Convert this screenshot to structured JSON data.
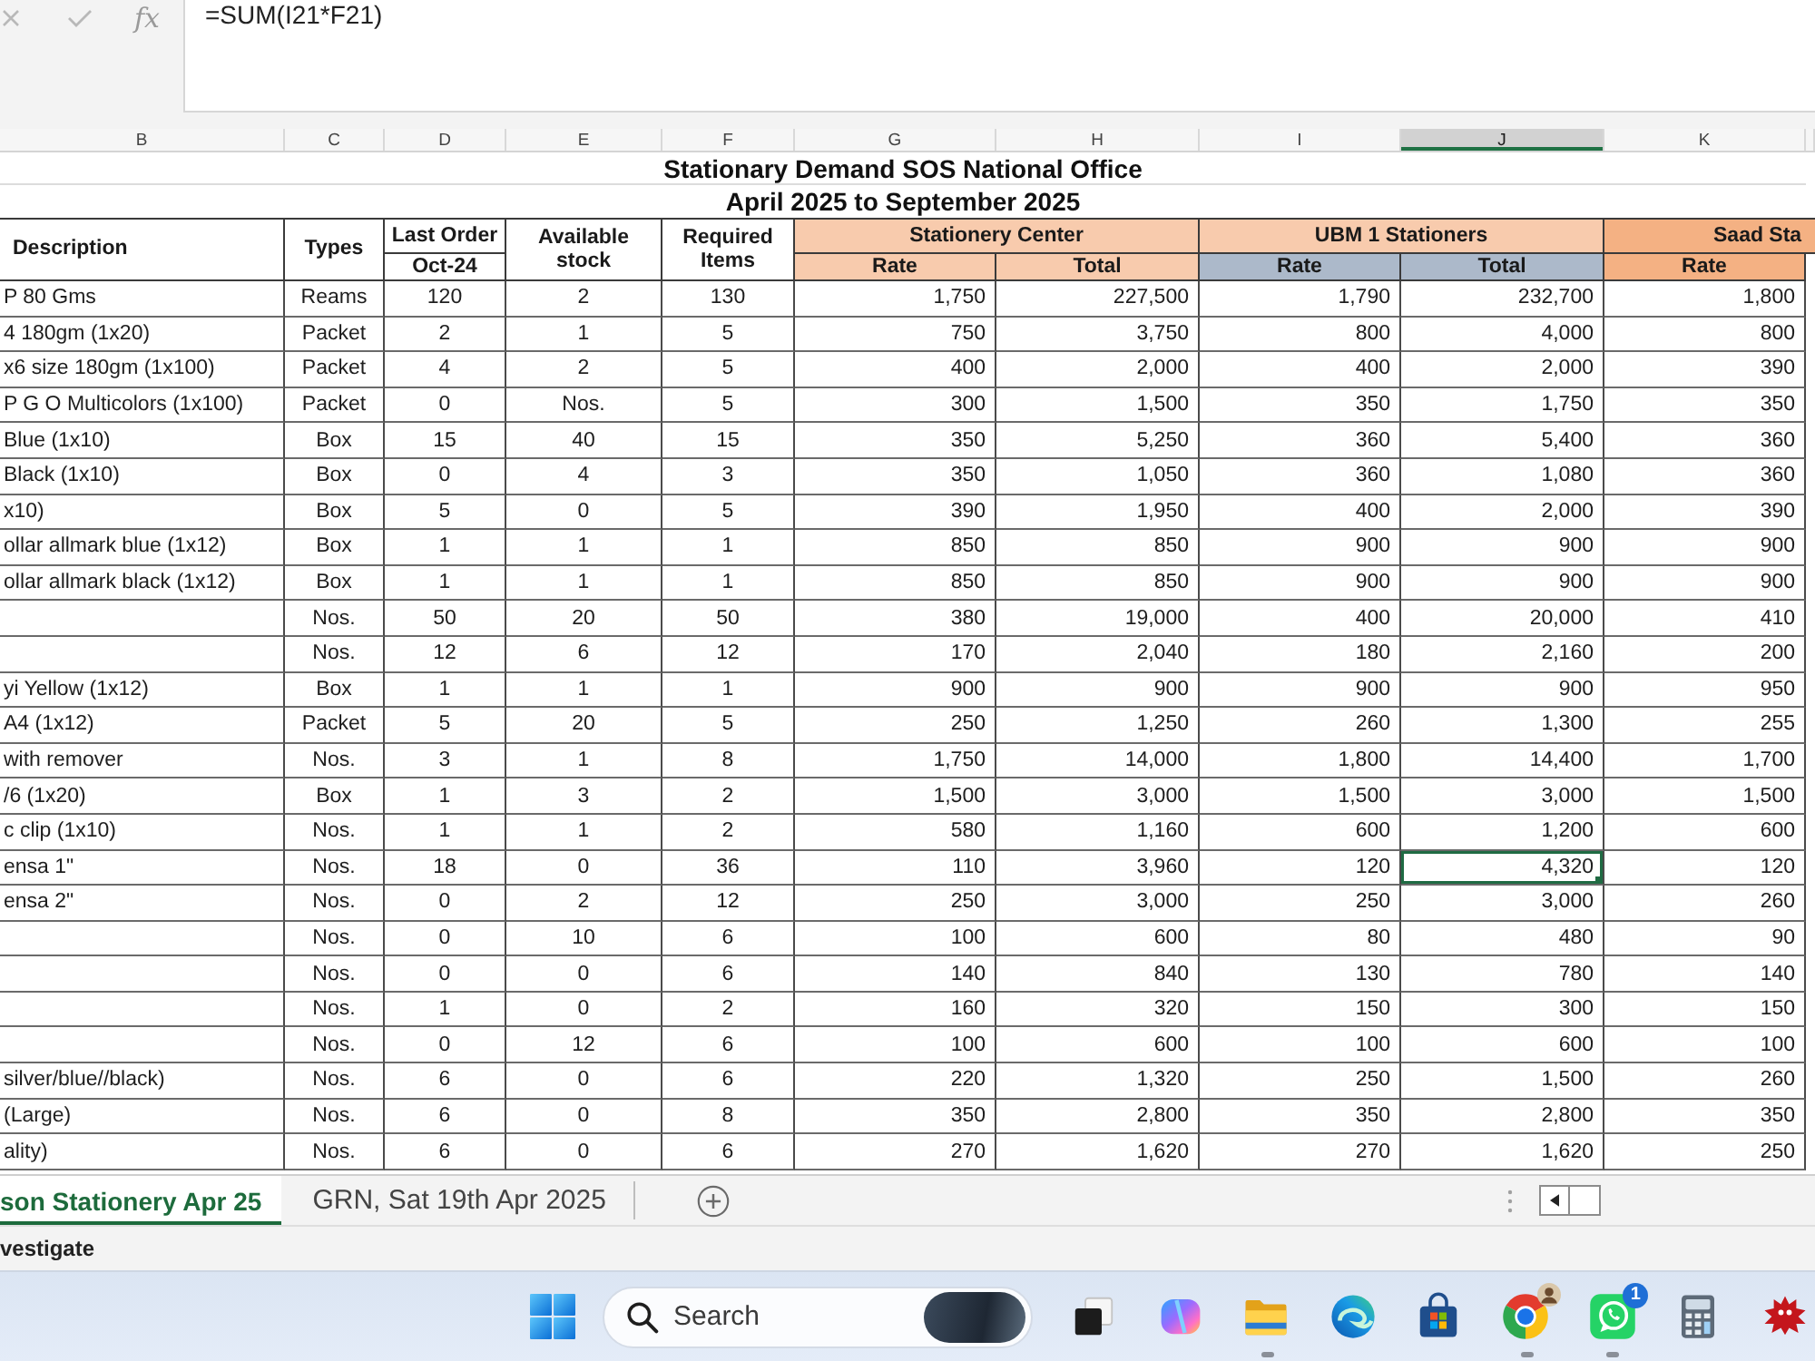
{
  "formula_bar": {
    "function_label": "fx",
    "formula": "=SUM(I21*F21)"
  },
  "column_headers": [
    {
      "label": "B",
      "selected": false
    },
    {
      "label": "C",
      "selected": false
    },
    {
      "label": "D",
      "selected": false
    },
    {
      "label": "E",
      "selected": false
    },
    {
      "label": "F",
      "selected": false
    },
    {
      "label": "G",
      "selected": false
    },
    {
      "label": "H",
      "selected": false
    },
    {
      "label": "I",
      "selected": false
    },
    {
      "label": "J",
      "selected": true
    },
    {
      "label": "K",
      "selected": false
    }
  ],
  "sheet": {
    "title": "Stationary Demand SOS National Office",
    "subtitle": "April 2025 to September 2025",
    "fixed_headers": [
      {
        "label": "Description"
      },
      {
        "label": "Types"
      },
      {
        "label": "Last Order",
        "sublabel": "Oct-24"
      },
      {
        "label": "Available stock"
      },
      {
        "label": "Required Items"
      }
    ],
    "vendors": [
      {
        "name": "Stationery Center",
        "color": "#f8cbad",
        "subheads": [
          {
            "label": "Rate",
            "color": "#f8cbad"
          },
          {
            "label": "Total",
            "color": "#f8cbad"
          }
        ]
      },
      {
        "name": "UBM 1 Stationers",
        "color": "#f8cbad",
        "subheads": [
          {
            "label": "Rate",
            "color": "#acb9ca"
          },
          {
            "label": "Total",
            "color": "#acb9ca"
          }
        ]
      },
      {
        "name": "Saad Sta",
        "color": "#f4b183",
        "subheads": [
          {
            "label": "Rate",
            "color": "#f4b183"
          }
        ]
      }
    ],
    "rows": [
      {
        "description": "P 80 Gms",
        "cells": [
          "Reams",
          "120",
          "2",
          "130",
          "1,750",
          "227,500",
          "1,790",
          "232,700",
          "1,800"
        ],
        "selected": false
      },
      {
        "description": "4 180gm (1x20)",
        "cells": [
          "Packet",
          "2",
          "1",
          "5",
          "750",
          "3,750",
          "800",
          "4,000",
          "800"
        ],
        "selected": false
      },
      {
        "description": "x6 size 180gm (1x100)",
        "cells": [
          "Packet",
          "4",
          "2",
          "5",
          "400",
          "2,000",
          "400",
          "2,000",
          "390"
        ],
        "selected": false
      },
      {
        "description": "P G O Multicolors (1x100)",
        "cells": [
          "Packet",
          "0",
          "Nos.",
          "5",
          "300",
          "1,500",
          "350",
          "1,750",
          "350"
        ],
        "selected": false
      },
      {
        "description": "Blue (1x10)",
        "cells": [
          "Box",
          "15",
          "40",
          "15",
          "350",
          "5,250",
          "360",
          "5,400",
          "360"
        ],
        "selected": false
      },
      {
        "description": "Black (1x10)",
        "cells": [
          "Box",
          "0",
          "4",
          "3",
          "350",
          "1,050",
          "360",
          "1,080",
          "360"
        ],
        "selected": false
      },
      {
        "description": "x10)",
        "cells": [
          "Box",
          "5",
          "0",
          "5",
          "390",
          "1,950",
          "400",
          "2,000",
          "390"
        ],
        "selected": false
      },
      {
        "description": "ollar allmark blue (1x12)",
        "cells": [
          "Box",
          "1",
          "1",
          "1",
          "850",
          "850",
          "900",
          "900",
          "900"
        ],
        "selected": false
      },
      {
        "description": "ollar allmark black (1x12)",
        "cells": [
          "Box",
          "1",
          "1",
          "1",
          "850",
          "850",
          "900",
          "900",
          "900"
        ],
        "selected": false
      },
      {
        "cells": [
          "Nos.",
          "50",
          "20",
          "50",
          "380",
          "19,000",
          "400",
          "20,000",
          "410"
        ],
        "selected": false
      },
      {
        "cells": [
          "Nos.",
          "12",
          "6",
          "12",
          "170",
          "2,040",
          "180",
          "2,160",
          "200"
        ],
        "selected": false
      },
      {
        "description": "yi Yellow (1x12)",
        "cells": [
          "Box",
          "1",
          "1",
          "1",
          "900",
          "900",
          "900",
          "900",
          "950"
        ],
        "selected": false
      },
      {
        "description": "A4 (1x12)",
        "cells": [
          "Packet",
          "5",
          "20",
          "5",
          "250",
          "1,250",
          "260",
          "1,300",
          "255"
        ],
        "selected": false
      },
      {
        "description": "with remover",
        "cells": [
          "Nos.",
          "3",
          "1",
          "8",
          "1,750",
          "14,000",
          "1,800",
          "14,400",
          "1,700"
        ],
        "selected": false
      },
      {
        "description": "/6 (1x20)",
        "cells": [
          "Box",
          "1",
          "3",
          "2",
          "1,500",
          "3,000",
          "1,500",
          "3,000",
          "1,500"
        ],
        "selected": false
      },
      {
        "description": "c clip (1x10)",
        "cells": [
          "Nos.",
          "1",
          "1",
          "2",
          "580",
          "1,160",
          "600",
          "1,200",
          "600"
        ],
        "selected": false
      },
      {
        "description": "ensa 1\"",
        "cells": [
          "Nos.",
          "18",
          "0",
          "36",
          "110",
          "3,960",
          "120",
          "4,320",
          "120"
        ],
        "selected": true
      },
      {
        "description": "ensa 2\"",
        "cells": [
          "Nos.",
          "0",
          "2",
          "12",
          "250",
          "3,000",
          "250",
          "3,000",
          "260"
        ],
        "selected": false
      },
      {
        "cells": [
          "Nos.",
          "0",
          "10",
          "6",
          "100",
          "600",
          "80",
          "480",
          "90"
        ],
        "selected": false
      },
      {
        "cells": [
          "Nos.",
          "0",
          "0",
          "6",
          "140",
          "840",
          "130",
          "780",
          "140"
        ],
        "selected": false
      },
      {
        "cells": [
          "Nos.",
          "1",
          "0",
          "2",
          "160",
          "320",
          "150",
          "300",
          "150"
        ],
        "selected": false
      },
      {
        "cells": [
          "Nos.",
          "0",
          "12",
          "6",
          "100",
          "600",
          "100",
          "600",
          "100"
        ],
        "selected": false
      },
      {
        "description": "silver/blue//black)",
        "cells": [
          "Nos.",
          "6",
          "0",
          "6",
          "220",
          "1,320",
          "250",
          "1,500",
          "260"
        ],
        "selected": false
      },
      {
        "description": "(Large)",
        "cells": [
          "Nos.",
          "6",
          "0",
          "8",
          "350",
          "2,800",
          "350",
          "2,800",
          "350"
        ],
        "selected": false
      },
      {
        "description": "ality)",
        "cells": [
          "Nos.",
          "6",
          "0",
          "6",
          "270",
          "1,620",
          "270",
          "1,620",
          "250"
        ],
        "selected": false
      }
    ]
  },
  "sheet_tabs": [
    {
      "label": "son Stationery Apr 25",
      "selected": true
    },
    {
      "label": "GRN, Sat 19th Apr 2025",
      "selected": false
    }
  ],
  "status_bar": {
    "text": "vestigate"
  },
  "taskbar": {
    "search": {
      "placeholder": "Search"
    },
    "apps": [
      {
        "kind": "tiles",
        "running": false
      },
      {
        "kind": "swirl",
        "running": false
      },
      {
        "kind": "folder",
        "running": true
      },
      {
        "kind": "wave",
        "running": false
      },
      {
        "kind": "bag",
        "running": false
      },
      {
        "kind": "tricolor",
        "running": true
      },
      {
        "kind": "chat",
        "running": true,
        "badge": "1"
      },
      {
        "kind": "calculator",
        "running": false
      },
      {
        "kind": "creature",
        "running": false
      }
    ]
  }
}
